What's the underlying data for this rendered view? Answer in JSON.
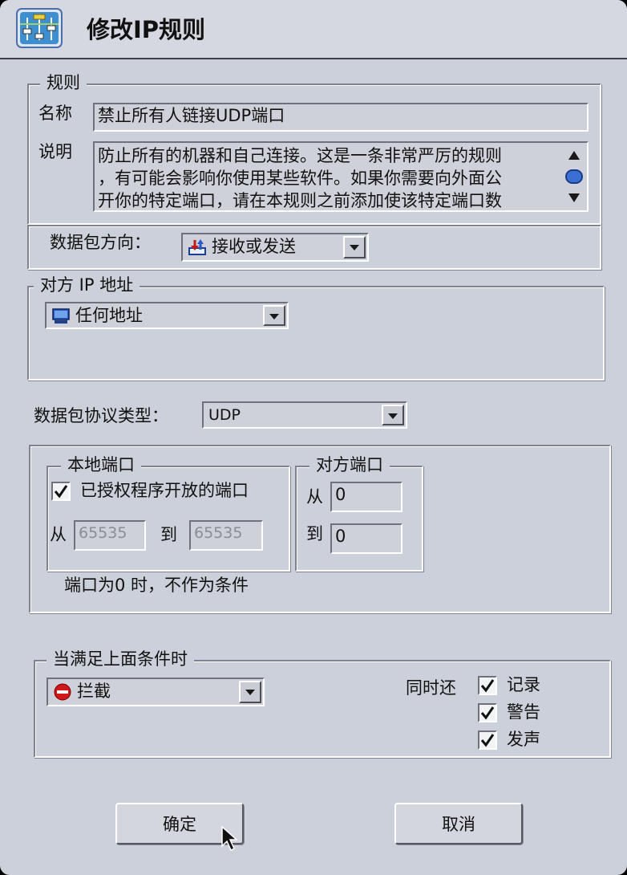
{
  "window": {
    "title": "修改IP规则"
  },
  "rule": {
    "legend": "规则",
    "name_label": "名称",
    "name_value": "禁止所有人链接UDP端口",
    "desc_label": "说明",
    "desc_lines": [
      "防止所有的机器和自己连接。这是一条非常严厉的规则",
      "，有可能会影响你使用某些软件。如果你需要向外面公",
      "开你的特定端口，请在本规则之前添加使该特定端口数"
    ]
  },
  "direction": {
    "label": "数据包方向：",
    "value": "接收或发送",
    "icon": "send-receive-icon"
  },
  "remote_ip": {
    "legend": "对方 IP 地址",
    "value": "任何地址",
    "icon": "computer-icon"
  },
  "protocol": {
    "label": "数据包协议类型：",
    "value": "UDP"
  },
  "local_port": {
    "legend": "本地端口",
    "authorized_label": "已授权程序开放的端口",
    "authorized_checked": true,
    "from_label": "从",
    "from_value": "65535",
    "to_label": "到",
    "to_value": "65535"
  },
  "remote_port": {
    "legend": "对方端口",
    "from_label": "从",
    "from_value": "0",
    "to_label": "到",
    "to_value": "0"
  },
  "port_note": "端口为0 时，不作为条件",
  "action": {
    "legend": "当满足上面条件时",
    "value": "拦截",
    "icon": "block-icon",
    "also_label": "同时还",
    "options": [
      {
        "label": "记录",
        "checked": true
      },
      {
        "label": "警告",
        "checked": true
      },
      {
        "label": "发声",
        "checked": true
      }
    ]
  },
  "buttons": {
    "ok": "确定",
    "cancel": "取消"
  },
  "colors": {
    "window_bg": "#ccd0da",
    "accent_blue": "#3b6fd1",
    "block_red": "#d01818"
  }
}
